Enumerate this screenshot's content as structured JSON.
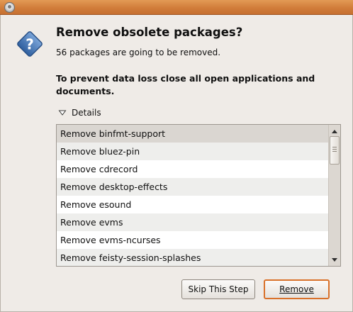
{
  "window": {
    "icon": "window-menu-icon"
  },
  "dialog": {
    "icon": "question-icon",
    "heading": "Remove obsolete packages?",
    "summary": "56 packages are going to be removed.",
    "warning": "To prevent data loss close all open applications and documents."
  },
  "details": {
    "label": "Details",
    "expanded": true,
    "items": [
      {
        "label": "Remove binfmt-support"
      },
      {
        "label": "Remove bluez-pin"
      },
      {
        "label": "Remove cdrecord"
      },
      {
        "label": "Remove desktop-effects"
      },
      {
        "label": "Remove esound"
      },
      {
        "label": "Remove evms"
      },
      {
        "label": "Remove evms-ncurses"
      },
      {
        "label": "Remove feisty-session-splashes"
      }
    ],
    "selected_index": 0
  },
  "buttons": {
    "skip": "Skip This Step",
    "remove": "Remove"
  },
  "colors": {
    "titlebar": "#d88743",
    "focus_border": "#d9712a",
    "question_icon": "#3e70b0"
  }
}
